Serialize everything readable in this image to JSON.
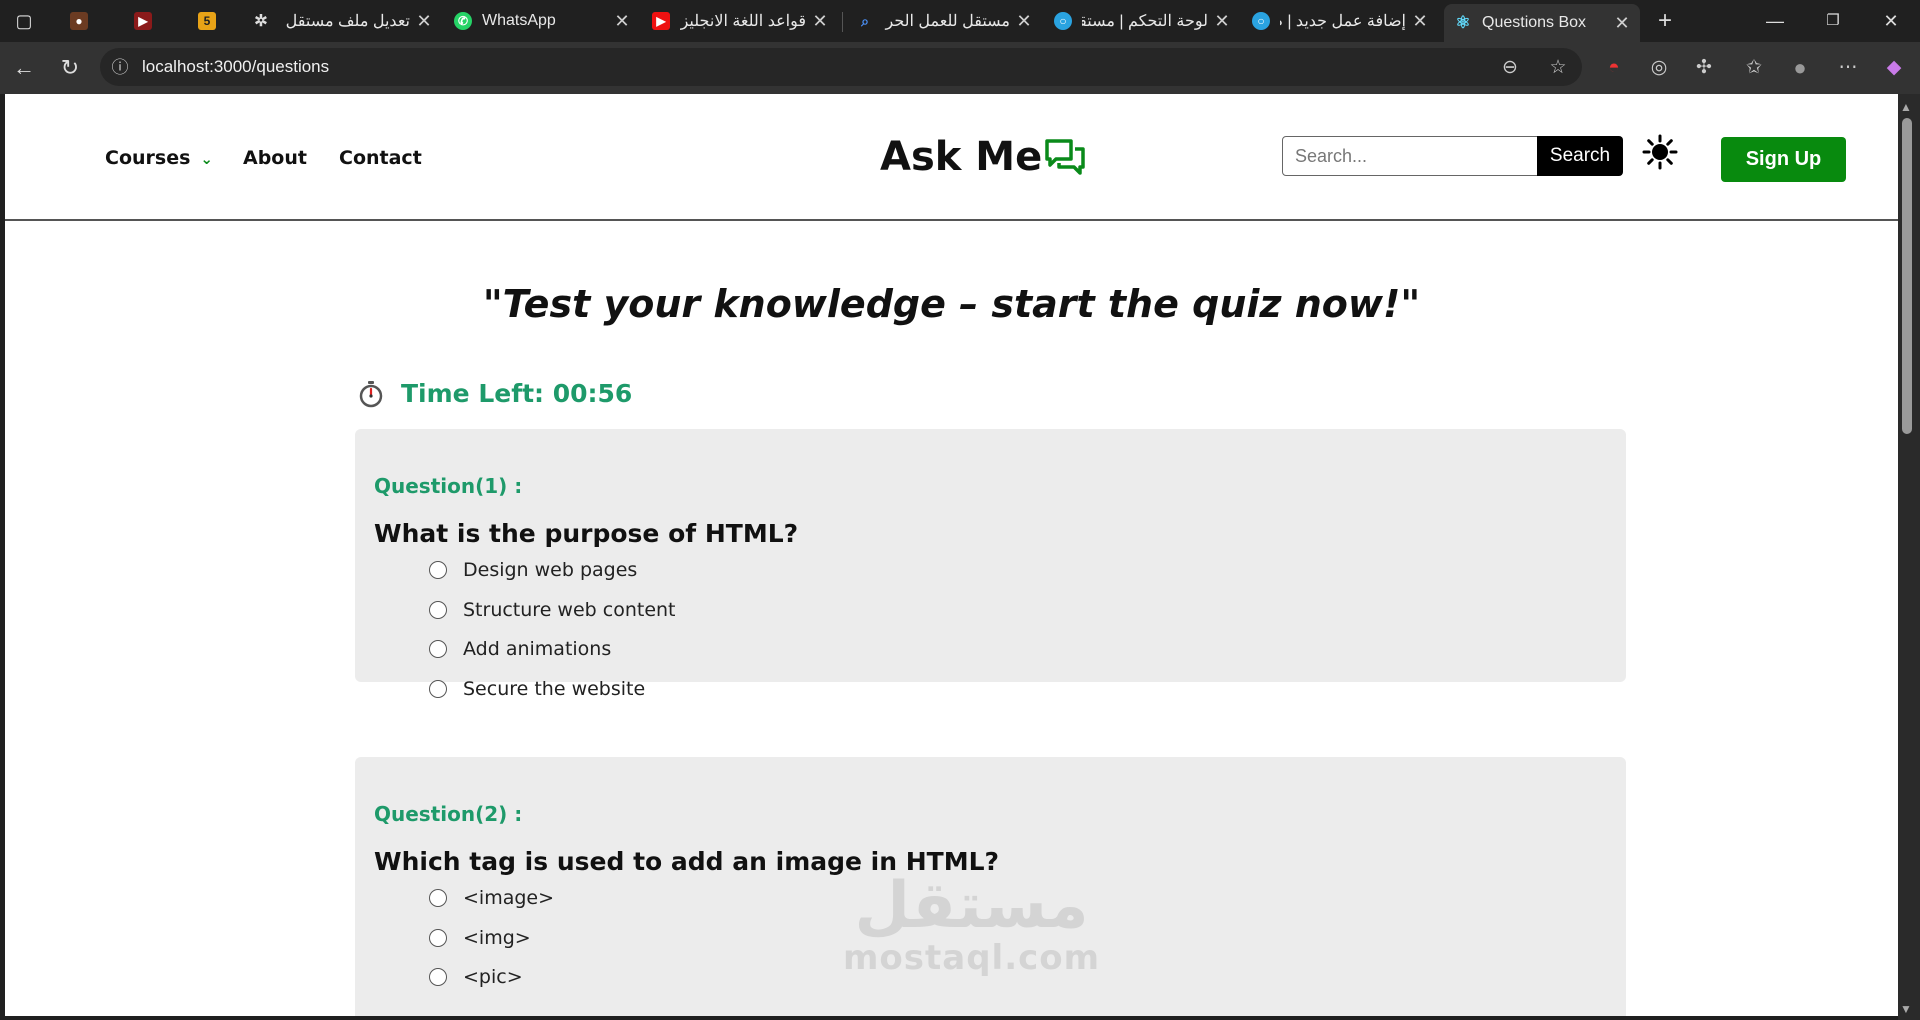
{
  "browser": {
    "tabs": [
      {
        "title": "",
        "icon": "ninja-favicon"
      },
      {
        "title": "",
        "icon": "youtube-favicon"
      },
      {
        "title": "",
        "icon": "html5-favicon"
      },
      {
        "title": "تعديل ملف مستقل",
        "icon": "chatgpt-favicon"
      },
      {
        "title": "WhatsApp",
        "icon": "whatsapp-favicon"
      },
      {
        "title": "قواعد اللغة الانجليزي",
        "icon": "youtube-favicon"
      },
      {
        "title": "مستقل للعمل الحر",
        "icon": "search-favicon"
      },
      {
        "title": "لوحة التحكم | مستقل",
        "icon": "mostaql-favicon"
      },
      {
        "title": "إضافة عمل جديد | م",
        "icon": "mostaql-favicon"
      },
      {
        "title": "Questions Box",
        "icon": "react-favicon"
      }
    ],
    "url": "localhost:3000/questions"
  },
  "header": {
    "nav": {
      "courses": "Courses",
      "about": "About",
      "contact": "Contact"
    },
    "logo_text": "Ask Me",
    "search": {
      "placeholder": "Search...",
      "button": "Search"
    },
    "signup": "Sign Up"
  },
  "main": {
    "tagline": "Test your knowledge – start the quiz now!",
    "quote_open": "\"",
    "quote_close": "\"",
    "timer_label": "Time Left: 00:56",
    "questions": [
      {
        "number": "Question(1) :",
        "text": "What is the purpose of HTML?",
        "options": [
          "Design web pages",
          "Structure web content",
          "Add animations",
          "Secure the website"
        ]
      },
      {
        "number": "Question(2) :",
        "text": "Which tag is used to add an image in HTML?",
        "options": [
          "<image>",
          "<img>",
          "<pic>"
        ]
      }
    ]
  },
  "watermark": {
    "arabic": "مستقل",
    "latin": "mostaql.com"
  },
  "colors": {
    "accent_green": "#088a0e",
    "teal": "#1e9a6a",
    "card_bg": "#ececec"
  }
}
